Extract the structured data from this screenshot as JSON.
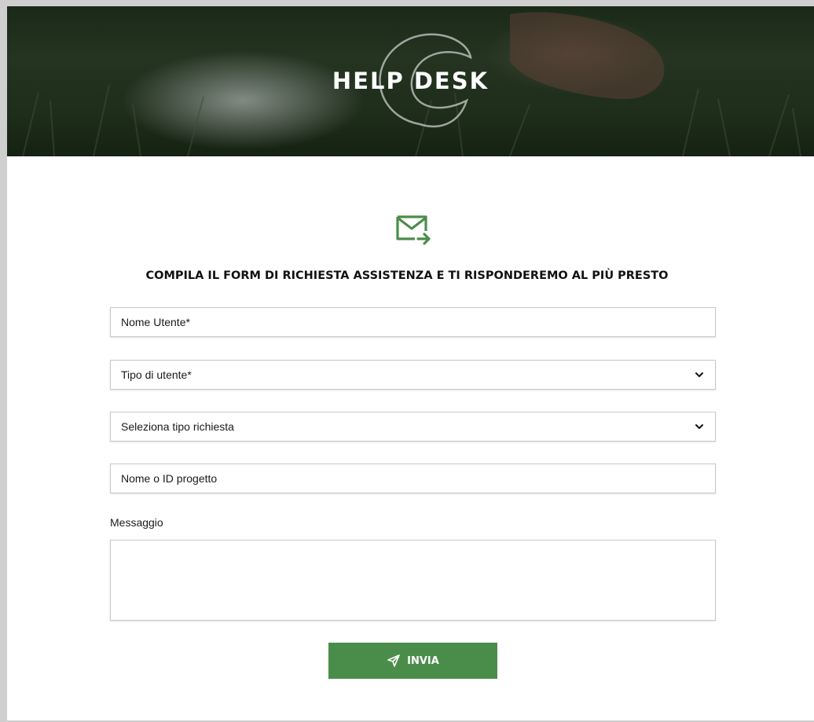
{
  "hero": {
    "title": "HELP DESK"
  },
  "heading": "COMPILA IL FORM DI RICHIESTA ASSISTENZA E TI RISPONDEREMO AL PIÙ PRESTO",
  "form": {
    "username": {
      "placeholder": "Nome Utente*",
      "value": ""
    },
    "user_type": {
      "selected": "Tipo di utente*"
    },
    "request_type": {
      "selected": "Seleziona tipo richiesta"
    },
    "project": {
      "placeholder": "Nome o ID progetto",
      "value": ""
    },
    "message_label": "Messaggio",
    "message": {
      "value": ""
    },
    "submit_label": "INVIA"
  },
  "icons": {
    "header_logo": "swirl-logo",
    "mail": "mail-send-icon",
    "select_arrow": "chevron-down-icon",
    "submit": "paper-plane-icon"
  },
  "colors": {
    "accent": "#4a8d4a",
    "border": "#c9c9c9",
    "frame": "#cfcfcf"
  }
}
